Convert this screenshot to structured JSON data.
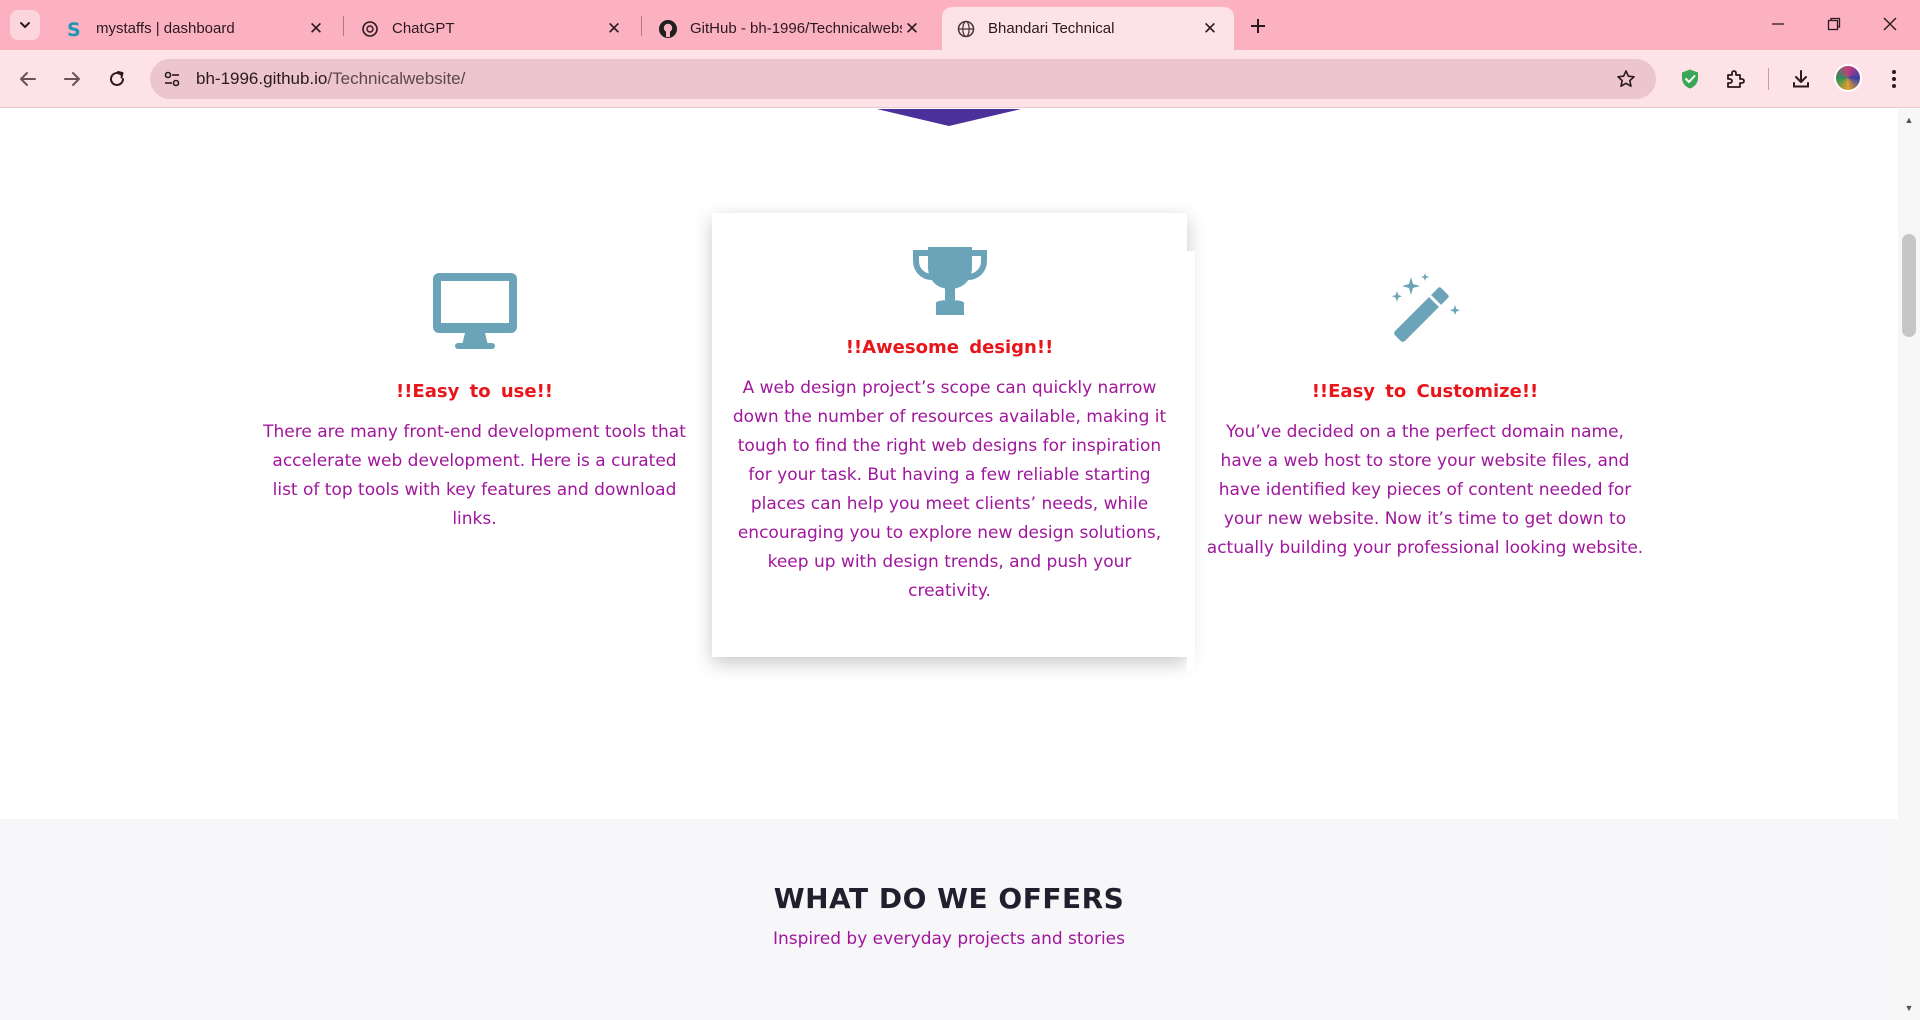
{
  "browser": {
    "tabs": [
      {
        "title": "mystaffs | dashboard",
        "favicon": "letter-s-icon",
        "active": false
      },
      {
        "title": "ChatGPT",
        "favicon": "chatgpt-icon",
        "active": false
      },
      {
        "title": "GitHub - bh-1996/Technicalwebsite",
        "favicon": "github-icon",
        "active": false
      },
      {
        "title": "Bhandari Technical",
        "favicon": "globe-icon",
        "active": true
      }
    ],
    "url_host": "bh-1996.github.io",
    "url_path": "/Technicalwebsite/",
    "colors": {
      "tabstrip": "#fbb1c0",
      "toolbar": "#fde2e8",
      "omnibox": "#ecc5ce"
    }
  },
  "features": [
    {
      "icon": "monitor-icon",
      "title": "!!Easy to use!!",
      "text": "There are many front-end development tools that accelerate web development. Here is a curated list of top tools with key features and download links."
    },
    {
      "icon": "trophy-icon",
      "title": "!!Awesome design!!",
      "text": "A web design project’s scope can quickly narrow down the number of resources available, making it tough to find the right web designs for inspiration for your task. But having a few reliable starting places can help you meet clients’ needs, while encouraging you to explore new design solutions, keep up with design trends, and push your creativity."
    },
    {
      "icon": "magic-wand-icon",
      "title": "!!Easy to Customize!!",
      "text": "You’ve decided on a the perfect domain name, have a web host to store your website files, and have identified key pieces of content needed for your new website. Now it’s time to get down to actually building your professional looking website."
    }
  ],
  "offers": {
    "heading": "WHAT DO WE OFFERS",
    "subheading": "Inspired by everyday projects and stories"
  },
  "theme": {
    "icon_color": "#6ba3b8",
    "title_color": "#e8151b",
    "text_color": "#a0169c"
  }
}
